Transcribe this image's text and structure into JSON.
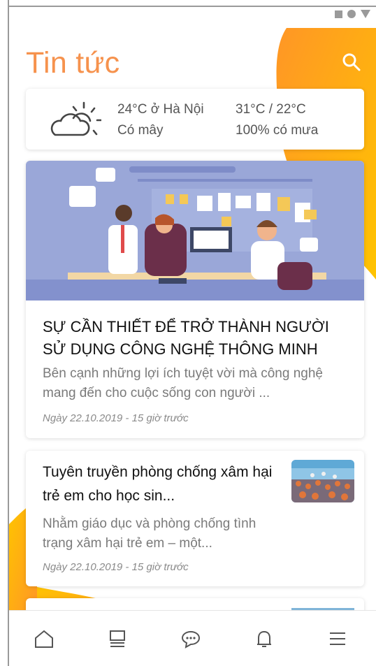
{
  "app": {
    "title": "Tin tức",
    "accent_color": "#f6924d",
    "gradient_colors": [
      "#ffc400",
      "#ff9626"
    ]
  },
  "status_bar": {
    "icons": [
      "square-icon",
      "circle-icon",
      "triangle-icon"
    ]
  },
  "weather": {
    "icon": "partly-cloudy-icon",
    "temperature_location": "24°C ở Hà Nội",
    "condition": "Có mây",
    "high_low": "31°C / 22°C",
    "rain_chance": "100% có mưa"
  },
  "featured": {
    "image": "office-teamwork-illustration",
    "title": "SỰ CẦN THIẾT ĐỂ TRỞ THÀNH NGƯỜI SỬ DỤNG CÔNG NGHỆ THÔNG MINH",
    "description": "Bên cạnh những lợi ích tuyệt vời mà công nghệ mang đến cho cuộc sống con người ...",
    "date": "Ngày 22.10.2019 - 15 giờ trước"
  },
  "news": [
    {
      "title": "Tuyên truyền phòng chống xâm hại trẻ em cho học sin...",
      "description": "Nhằm giáo dục và phòng chống tình trạng xâm hại trẻ em – một...",
      "date": "Ngày 22.10.2019 - 15 giờ trước",
      "thumbnail": "school-crowd-photo"
    }
  ],
  "bottom_nav": {
    "items": [
      {
        "icon": "home-icon"
      },
      {
        "icon": "news-icon"
      },
      {
        "icon": "chat-icon"
      },
      {
        "icon": "bell-icon"
      },
      {
        "icon": "menu-icon"
      }
    ]
  }
}
